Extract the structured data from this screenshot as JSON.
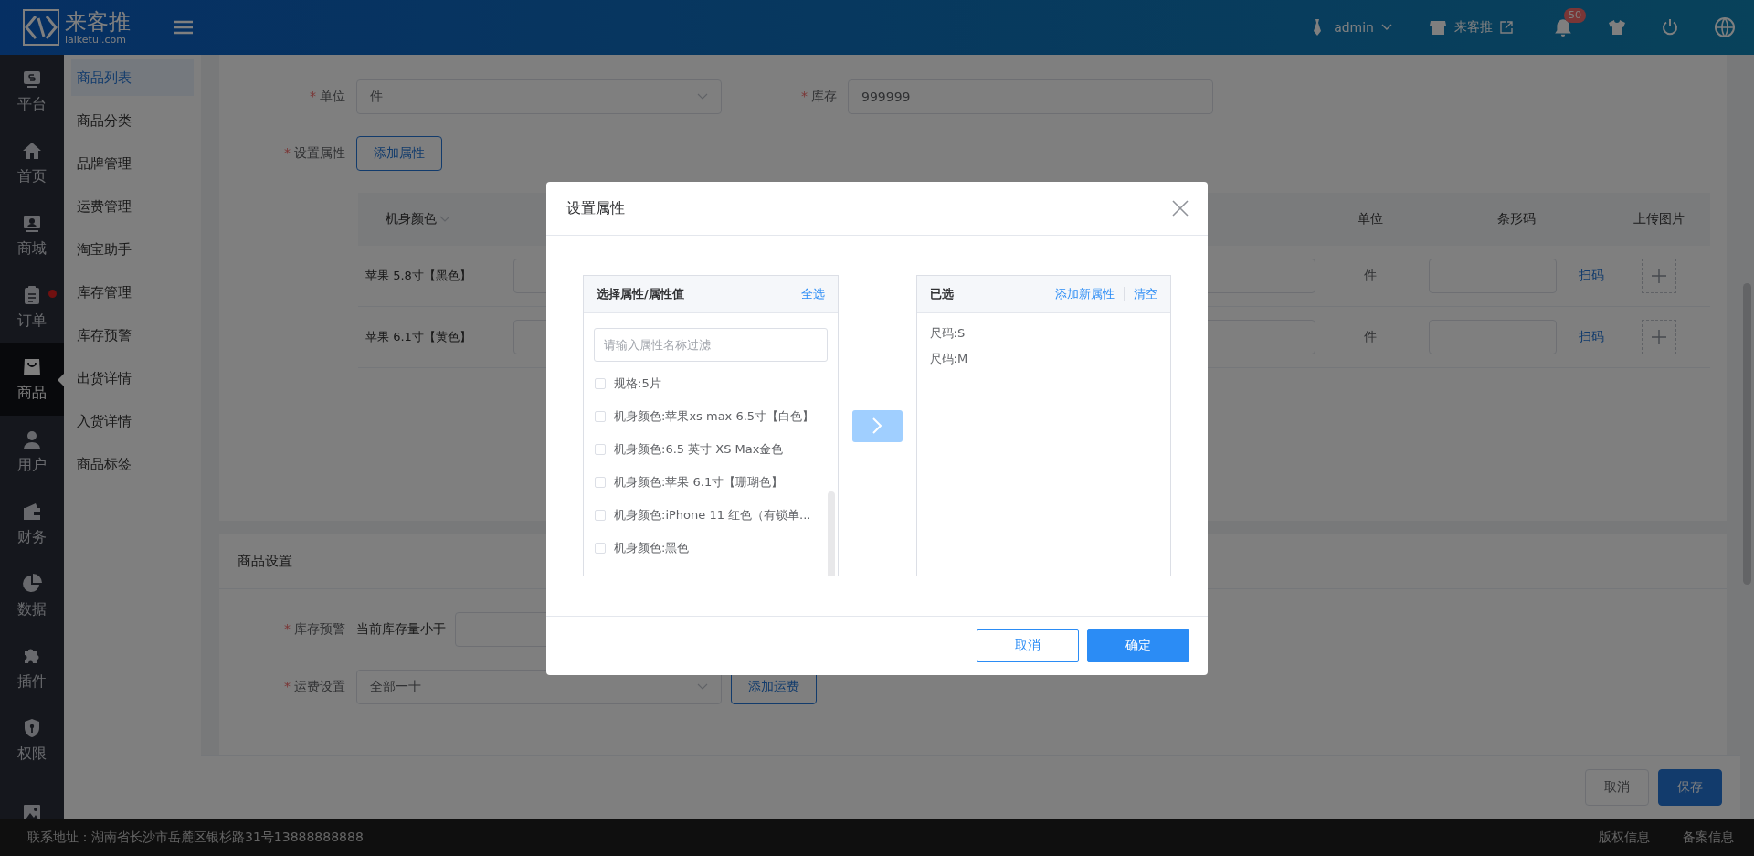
{
  "header": {
    "logo_text": "来客推",
    "logo_domain": "laiketui.com",
    "user": "admin",
    "store": "来客推",
    "notification_count": "50"
  },
  "nav": [
    {
      "label": "平台",
      "selected": false,
      "dot": false
    },
    {
      "label": "首页",
      "selected": false,
      "dot": false
    },
    {
      "label": "商城",
      "selected": false,
      "dot": false
    },
    {
      "label": "订单",
      "selected": false,
      "dot": true
    },
    {
      "label": "商品",
      "selected": true,
      "dot": false
    },
    {
      "label": "用户",
      "selected": false,
      "dot": false
    },
    {
      "label": "财务",
      "selected": false,
      "dot": false
    },
    {
      "label": "数据",
      "selected": false,
      "dot": false
    },
    {
      "label": "插件",
      "selected": false,
      "dot": false
    },
    {
      "label": "权限",
      "selected": false,
      "dot": false
    },
    {
      "selected": false,
      "dot": false
    }
  ],
  "submenu": [
    {
      "label": "商品列表",
      "selected": true
    },
    {
      "label": "商品分类",
      "selected": false
    },
    {
      "label": "品牌管理",
      "selected": false
    },
    {
      "label": "运费管理",
      "selected": false
    },
    {
      "label": "淘宝助手",
      "selected": false
    },
    {
      "label": "库存管理",
      "selected": false
    },
    {
      "label": "库存预警",
      "selected": false
    },
    {
      "label": "出货详情",
      "selected": false
    },
    {
      "label": "入货详情",
      "selected": false
    },
    {
      "label": "商品标签",
      "selected": false
    }
  ],
  "form": {
    "unit_mark": "*",
    "unit_label": "单位",
    "unit_value": "件",
    "stock_mark": "*",
    "stock_label": "库存",
    "stock_value": "999999",
    "attr_mark": "*",
    "attr_label": "设置属性",
    "attr_button": "添加属性"
  },
  "table": {
    "columns": [
      "机身颜色",
      "单位",
      "条形码",
      "上传图片"
    ],
    "rows": [
      {
        "variant": "苹果 5.8寸【黑色】",
        "unit": "件",
        "scan": "扫码"
      },
      {
        "variant": "苹果 6.1寸【黄色】",
        "unit": "件",
        "scan": "扫码"
      }
    ]
  },
  "settings": {
    "title": "商品设置",
    "stock_warning_mark": "*",
    "stock_warning_label": "库存预警",
    "stock_warning_prefix": "当前库存量小于",
    "shipping_mark": "*",
    "shipping_label": "运费设置",
    "shipping_value": "全部一十",
    "shipping_button": "添加运费"
  },
  "actions": {
    "cancel": "取消",
    "save": "保存"
  },
  "footer": {
    "address": "联系地址：湖南省长沙市岳麓区银杉路31号13888888888",
    "links": [
      "版权信息",
      "备案信息"
    ]
  },
  "dialog": {
    "title": "设置属性",
    "source": {
      "title": "选择属性/属性值",
      "select_all": "全选",
      "placeholder": "请输入属性名称过滤",
      "items": [
        {
          "label": "规格:5片",
          "checked": false
        },
        {
          "label": "机身颜色:苹果xs max 6.5寸【白色】",
          "checked": false
        },
        {
          "label": "机身颜色:6.5 英寸 XS Max金色",
          "checked": false
        },
        {
          "label": "机身颜色:苹果 6.1寸【珊瑚色】",
          "checked": false
        },
        {
          "label": "机身颜色:iPhone 11 红色（有锁单...",
          "checked": false
        },
        {
          "label": "机身颜色:黑色",
          "checked": false
        }
      ]
    },
    "transfer_disabled": true,
    "target": {
      "title": "已选",
      "add_new": "添加新属性",
      "clear": "清空",
      "items": [
        "尺码:S",
        "尺码:M"
      ]
    },
    "cancel": "取消",
    "confirm": "确定"
  }
}
